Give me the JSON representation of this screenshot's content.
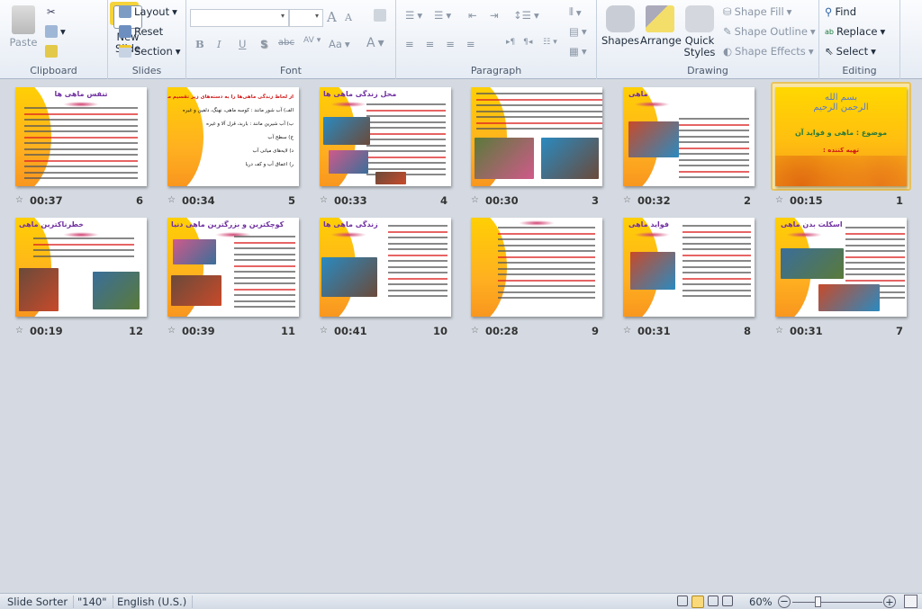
{
  "ribbon": {
    "clipboard": {
      "label": "Clipboard",
      "paste": "Paste"
    },
    "slides": {
      "label": "Slides",
      "new_slide": "New Slide",
      "layout": "Layout",
      "reset": "Reset",
      "section": "Section"
    },
    "font": {
      "label": "Font",
      "font_name": "",
      "font_size": "",
      "bold": "B",
      "italic": "I",
      "underline": "U",
      "shadow": "S",
      "strike": "abc",
      "spacing": "AV",
      "case": "Aa",
      "color": "A",
      "grow": "A",
      "shrink": "A"
    },
    "paragraph": {
      "label": "Paragraph"
    },
    "drawing": {
      "label": "Drawing",
      "shapes": "Shapes",
      "arrange": "Arrange",
      "quick_styles": "Quick Styles",
      "shape_fill": "Shape Fill",
      "shape_outline": "Shape Outline",
      "shape_effects": "Shape Effects"
    },
    "editing": {
      "label": "Editing",
      "find": "Find",
      "replace": "Replace",
      "select": "Select"
    }
  },
  "slides": [
    {
      "number": "1",
      "time": "00:15",
      "selected": true,
      "title": "",
      "logo_text": "بسم الله الرحمن الرحیم",
      "subject": "موضوع : ماهی و فواید آن",
      "author": "تهیه کننده :"
    },
    {
      "number": "2",
      "time": "00:32",
      "title": "ماهی"
    },
    {
      "number": "3",
      "time": "00:30",
      "title": ""
    },
    {
      "number": "4",
      "time": "00:33",
      "title": "محل زندگی ماهی ها"
    },
    {
      "number": "5",
      "time": "00:34",
      "title": "",
      "bullets": [
        "از لحاظ زندگی ماهی‌ها را به دسته‌های زیر تقسیم می‌کنند:",
        "الف) آب شور مانند : کوسه ماهی، نهنگ، دلفین و غیره",
        "ب) آب شیرین مانند : باربد، قزل آلا و غیره",
        "ج) سطح آب",
        "د) لایه‌های میانی آب",
        "ر) اعماق آب و کف دریا"
      ]
    },
    {
      "number": "6",
      "time": "00:37",
      "title": "تنفس ماهی ها"
    },
    {
      "number": "7",
      "time": "00:31",
      "title": "اسکلت بدن ماهی"
    },
    {
      "number": "8",
      "time": "00:31",
      "title": "فواید ماهی"
    },
    {
      "number": "9",
      "time": "00:28",
      "title": ""
    },
    {
      "number": "10",
      "time": "00:41",
      "title": "زندگی ماهی ها"
    },
    {
      "number": "11",
      "time": "00:39",
      "title": "کوچکترین و بزرگترین ماهی دنیا"
    },
    {
      "number": "12",
      "time": "00:19",
      "title": "خطرناکترین ماهی"
    }
  ],
  "status": {
    "view": "Slide Sorter",
    "theme": "\"140\"",
    "language": "English (U.S.)",
    "zoom": "60%",
    "zoom_level": 60
  },
  "colors": {
    "accent_selected": "#e8c35c",
    "title_purple": "#7030a0",
    "slide_yellow": "#ffd400",
    "slide_orange": "#f7901e"
  }
}
